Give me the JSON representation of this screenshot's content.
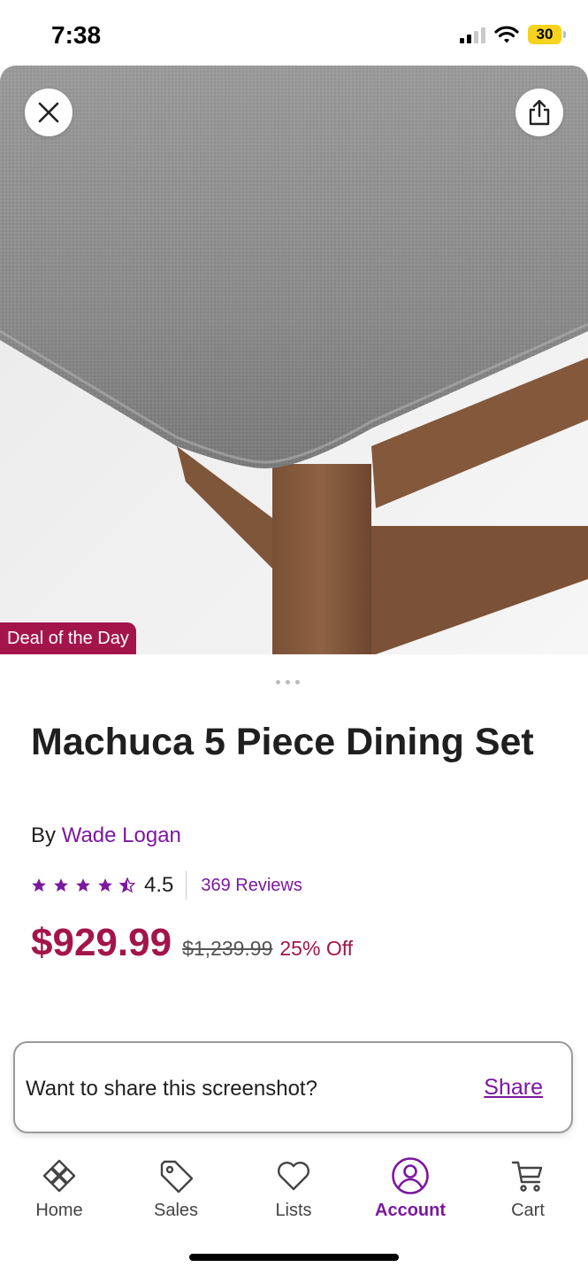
{
  "status_bar": {
    "time": "7:38",
    "battery": "30",
    "battery_color": "#f5d31e"
  },
  "hero": {
    "badge": "Deal of the Day"
  },
  "product": {
    "title": "Machuca 5 Piece Dining Set",
    "brand_prefix": "By",
    "brand": "Wade Logan",
    "rating": "4.5",
    "rating_stars": 4.5,
    "reviews": "369 Reviews",
    "sale_price": "$929.99",
    "original_price": "$1,239.99",
    "discount": "25% Off"
  },
  "share_toast": {
    "text": "Want to share this screenshot?",
    "link": "Share"
  },
  "tab_bar": {
    "items": [
      {
        "label": "Home",
        "icon": "home-icon"
      },
      {
        "label": "Sales",
        "icon": "tag-icon"
      },
      {
        "label": "Lists",
        "icon": "heart-icon"
      },
      {
        "label": "Account",
        "icon": "account-icon",
        "active": true
      },
      {
        "label": "Cart",
        "icon": "cart-icon"
      }
    ]
  },
  "colors": {
    "accent": "#7b189f",
    "sale": "#a3154a"
  }
}
